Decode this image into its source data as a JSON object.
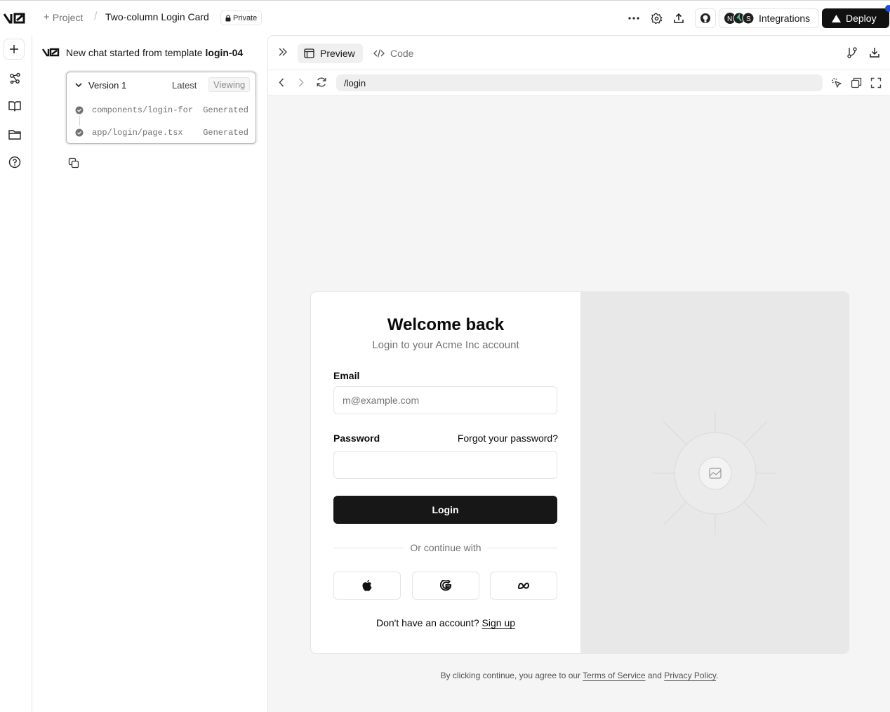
{
  "topbar": {
    "project_label": "Project",
    "chat_title": "Two-column Login Card",
    "visibility_badge": "Private",
    "integrations_label": "Integrations",
    "deploy_label": "Deploy"
  },
  "chat": {
    "intro_text": "New chat started from template",
    "template_name": "login-04",
    "version": {
      "title": "Version 1",
      "latest_label": "Latest",
      "viewing_label": "Viewing",
      "files": [
        {
          "name": "components/login-for...",
          "status": "Generated"
        },
        {
          "name": "app/login/page.tsx",
          "status": "Generated"
        }
      ]
    }
  },
  "panel": {
    "tabs": {
      "preview": "Preview",
      "code": "Code"
    },
    "url_path": "/login"
  },
  "preview": {
    "heading": "Welcome back",
    "subheading": "Login to your Acme Inc account",
    "email_label": "Email",
    "email_placeholder": "m@example.com",
    "password_label": "Password",
    "forgot_link": "Forgot your password?",
    "login_button": "Login",
    "divider_text": "Or continue with",
    "signup_prompt": "Don't have an account?",
    "signup_link": "Sign up",
    "footer_prefix": "By clicking continue, you agree to our",
    "footer_terms": "Terms of Service",
    "footer_and": "and",
    "footer_privacy": "Privacy Policy",
    "footer_suffix": "."
  },
  "icons": {
    "social": [
      "apple-icon",
      "google-icon",
      "meta-icon"
    ]
  }
}
